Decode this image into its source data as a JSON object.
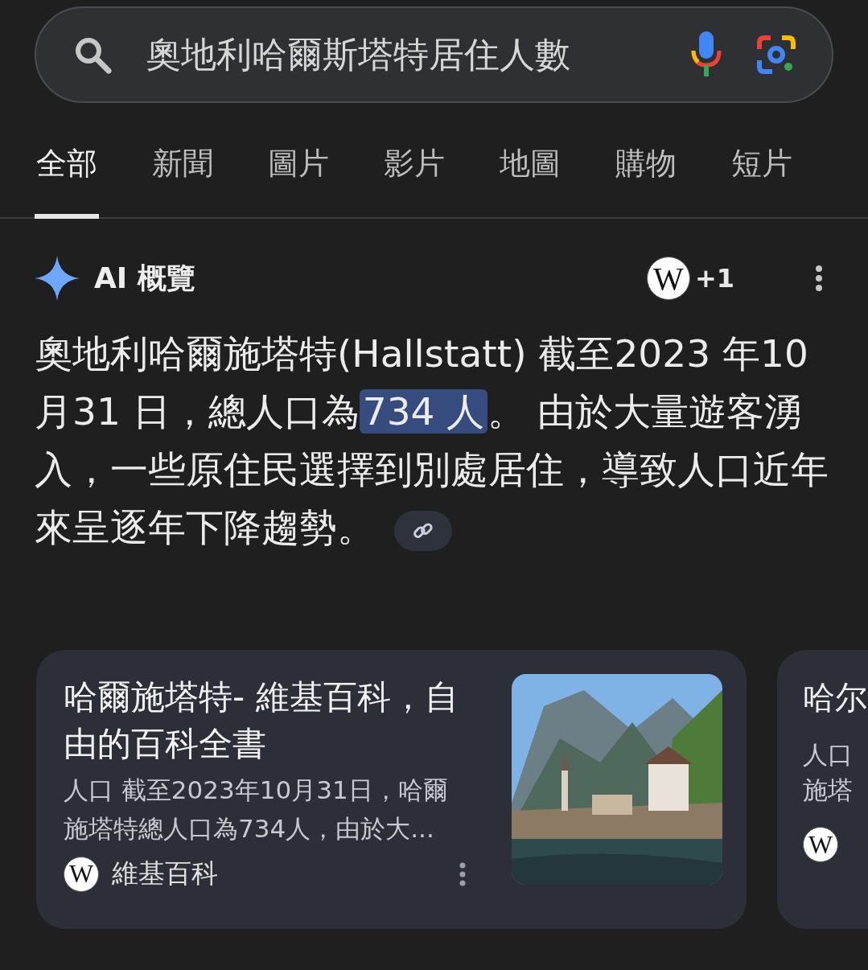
{
  "search": {
    "value": "奧地利哈爾斯塔特居住人數"
  },
  "tabs": [
    {
      "label": "全部",
      "selected": true
    },
    {
      "label": "新聞",
      "selected": false
    },
    {
      "label": "圖片",
      "selected": false
    },
    {
      "label": "影片",
      "selected": false
    },
    {
      "label": "地圖",
      "selected": false
    },
    {
      "label": "購物",
      "selected": false
    },
    {
      "label": "短片",
      "selected": false
    }
  ],
  "overview": {
    "title": "AI 概覽",
    "source_logo": "W",
    "source_count": "+1",
    "answer": {
      "before": "奧地利哈爾施塔特(Hallstatt) 截至2023 年10 月31 日，總人口為",
      "highlight": "734 人",
      "after": "。 由於大量遊客湧入，一些原住民選擇到別處居住，導致人口近年來呈逐年下降趨勢。"
    }
  },
  "cards": [
    {
      "title": "哈爾施塔特- 維基百科，自由的百科全書",
      "snippet": "人口 截至2023年10月31日，哈爾施塔特總人口為734人，由於大...",
      "source_logo": "W",
      "source": "維基百科"
    },
    {
      "title": "哈尔",
      "snippet": "人口",
      "snippet_2": "施塔",
      "source_logo": "W"
    }
  ]
}
